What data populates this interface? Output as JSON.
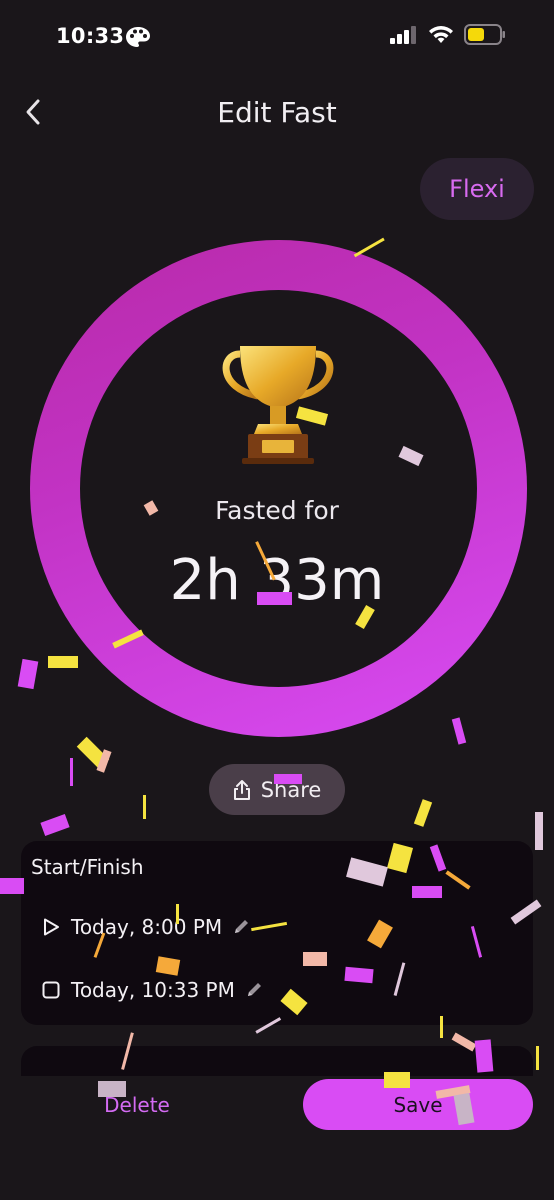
{
  "status_bar": {
    "time": "10:33",
    "icons": [
      "palette-icon",
      "signal-icon",
      "wifi-icon",
      "battery-icon"
    ],
    "battery_color": "#f5d90a"
  },
  "header": {
    "title": "Edit Fast",
    "back_icon": "chevron-left-icon"
  },
  "mode_pill": {
    "label": "Flexi"
  },
  "summary": {
    "icon": "trophy-icon",
    "label": "Fasted for",
    "duration": "2h 33m",
    "progress": 1.0
  },
  "share": {
    "label": "Share",
    "icon": "share-icon"
  },
  "start_finish": {
    "title": "Start/Finish",
    "start": {
      "icon": "play-icon",
      "value": "Today, 8:00 PM",
      "edit_icon": "pencil-icon"
    },
    "finish": {
      "icon": "stop-icon",
      "value": "Today, 10:33 PM",
      "edit_icon": "pencil-icon"
    }
  },
  "actions": {
    "delete_label": "Delete",
    "save_label": "Save"
  },
  "colors": {
    "background": "#1a161a",
    "accent": "#d94cf4",
    "ring_start": "#b82aa9",
    "card": "#0f0910",
    "confetti": [
      "#d94cf4",
      "#f5e340",
      "#e0c8dc",
      "#f5a93a",
      "#f2b8a8",
      "#c8b4c6"
    ]
  }
}
